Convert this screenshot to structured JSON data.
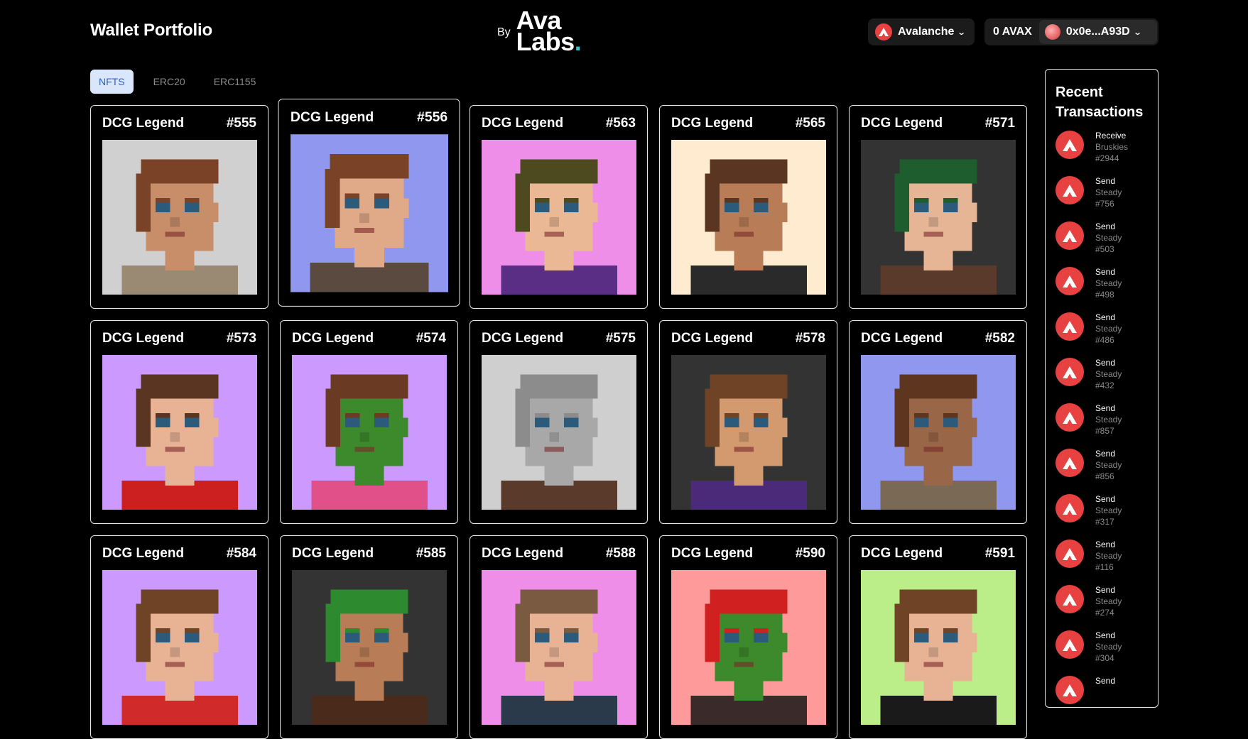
{
  "header": {
    "title": "Wallet Portfolio",
    "logo_by": "By",
    "logo_line1": "Ava",
    "logo_line2": "Labs",
    "logo_dot": "."
  },
  "network": {
    "label": "Avalanche",
    "icon": "avalanche-icon"
  },
  "wallet": {
    "balance": "0 AVAX",
    "address": "0x0e...A93D"
  },
  "tabs": [
    {
      "label": "NFTS",
      "active": true
    },
    {
      "label": "ERC20",
      "active": false
    },
    {
      "label": "ERC1155",
      "active": false
    }
  ],
  "nfts": [
    {
      "name": "DCG Legend",
      "id": "#555",
      "bg": "#d0d0d0",
      "skin": "#c88e6a",
      "hair": "#7a4328",
      "shirt": "#9a8a73"
    },
    {
      "name": "DCG Legend",
      "id": "#556",
      "bg": "#8f98ee",
      "skin": "#e0a988",
      "hair": "#7a4328",
      "shirt": "#5a4a40"
    },
    {
      "name": "DCG Legend",
      "id": "#563",
      "bg": "#ee8ee8",
      "skin": "#eab894",
      "hair": "#4d4a20",
      "shirt": "#5b2e86"
    },
    {
      "name": "DCG Legend",
      "id": "#565",
      "bg": "#ffecd0",
      "skin": "#b87d56",
      "hair": "#5a3622",
      "shirt": "#2a2a2a"
    },
    {
      "name": "DCG Legend",
      "id": "#571",
      "bg": "#333333",
      "skin": "#e6b596",
      "hair": "#1e5e2e",
      "shirt": "#5a3a2a"
    },
    {
      "name": "DCG Legend",
      "id": "#573",
      "bg": "#cc99ff",
      "skin": "#e8b294",
      "hair": "#5a3622",
      "shirt": "#cc2020"
    },
    {
      "name": "DCG Legend",
      "id": "#574",
      "bg": "#cc99ff",
      "skin": "#3d8a2c",
      "hair": "#6a3a22",
      "shirt": "#e2508a"
    },
    {
      "name": "DCG Legend",
      "id": "#575",
      "bg": "#cfcfcf",
      "skin": "#a8a8a8",
      "hair": "#8c8c8c",
      "shirt": "#5a3a2a"
    },
    {
      "name": "DCG Legend",
      "id": "#578",
      "bg": "#333333",
      "skin": "#d39a70",
      "hair": "#6e4326",
      "shirt": "#4c2a7a"
    },
    {
      "name": "DCG Legend",
      "id": "#582",
      "bg": "#8f98ee",
      "skin": "#9a6648",
      "hair": "#5e3620",
      "shirt": "#7a6a55"
    },
    {
      "name": "DCG Legend",
      "id": "#584",
      "bg": "#cc99ff",
      "skin": "#e8b294",
      "hair": "#6e4326",
      "shirt": "#d02a2a"
    },
    {
      "name": "DCG Legend",
      "id": "#585",
      "bg": "#333333",
      "skin": "#b87d56",
      "hair": "#2e8a2e",
      "shirt": "#4a2a1a"
    },
    {
      "name": "DCG Legend",
      "id": "#588",
      "bg": "#ee8ee8",
      "skin": "#e8b294",
      "hair": "#7a5a40",
      "shirt": "#2a3a4a"
    },
    {
      "name": "DCG Legend",
      "id": "#590",
      "bg": "#ff9a9a",
      "skin": "#3d8a2c",
      "hair": "#d02020",
      "shirt": "#3a2a2a"
    },
    {
      "name": "DCG Legend",
      "id": "#591",
      "bg": "#bbee88",
      "skin": "#e8b294",
      "hair": "#6e4326",
      "shirt": "#1a1a1a"
    }
  ],
  "transactions": {
    "title_line1": "Recent",
    "title_line2": "Transactions",
    "items": [
      {
        "type": "Receive",
        "name": "Bruskies",
        "id": "#2944"
      },
      {
        "type": "Send",
        "name": "Steady",
        "id": "#756"
      },
      {
        "type": "Send",
        "name": "Steady",
        "id": "#503"
      },
      {
        "type": "Send",
        "name": "Steady",
        "id": "#498"
      },
      {
        "type": "Send",
        "name": "Steady",
        "id": "#486"
      },
      {
        "type": "Send",
        "name": "Steady",
        "id": "#432"
      },
      {
        "type": "Send",
        "name": "Steady",
        "id": "#857"
      },
      {
        "type": "Send",
        "name": "Steady",
        "id": "#856"
      },
      {
        "type": "Send",
        "name": "Steady",
        "id": "#317"
      },
      {
        "type": "Send",
        "name": "Steady",
        "id": "#116"
      },
      {
        "type": "Send",
        "name": "Steady",
        "id": "#274"
      },
      {
        "type": "Send",
        "name": "Steady",
        "id": "#304"
      },
      {
        "type": "Send",
        "name": "",
        "id": ""
      }
    ]
  }
}
